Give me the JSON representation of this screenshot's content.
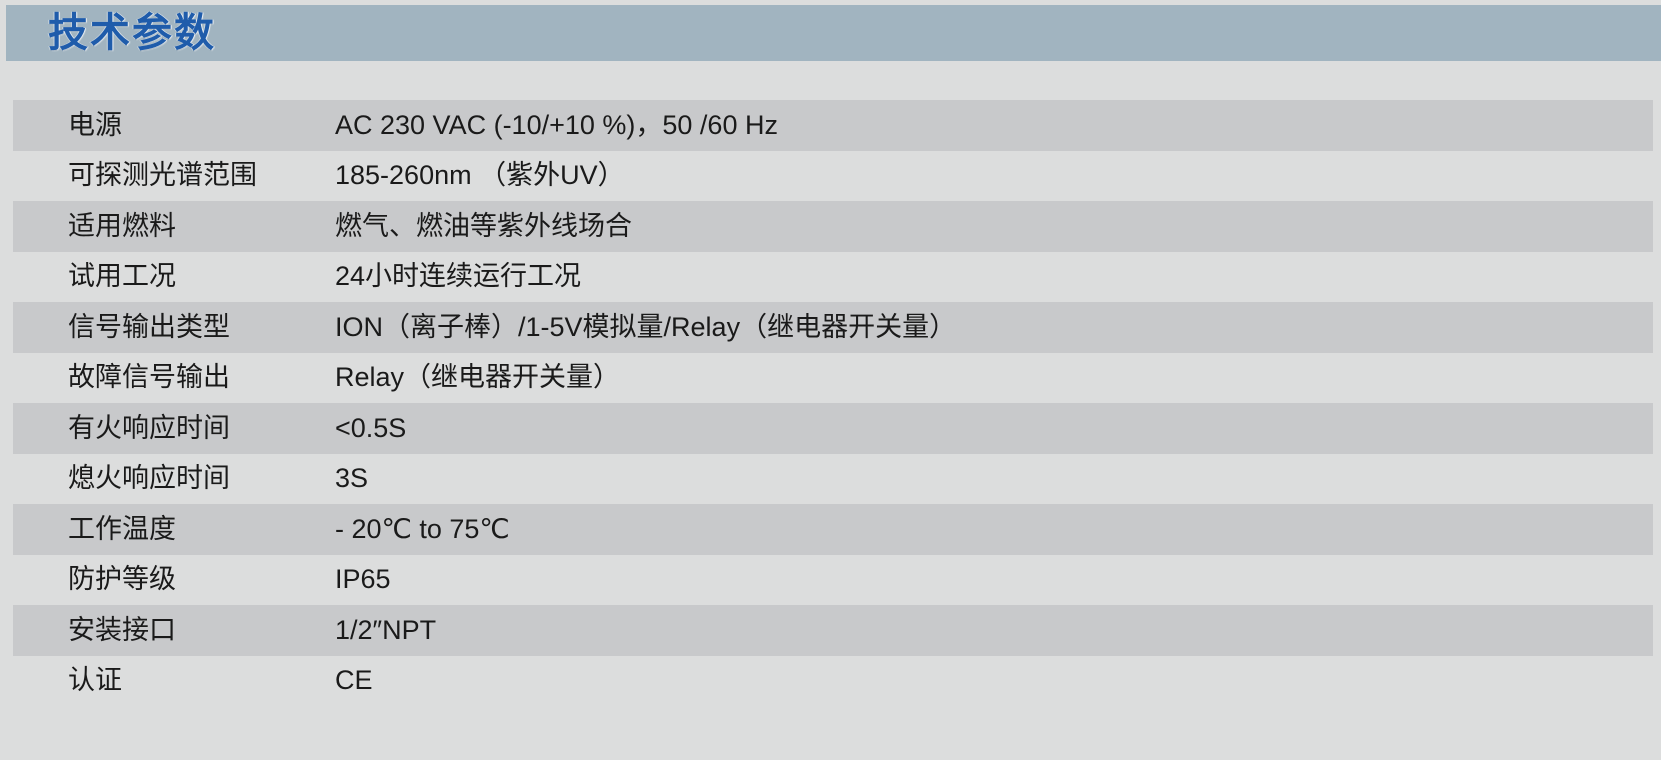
{
  "header": {
    "title": "技术参数",
    "band_color": "#a1b4c0",
    "title_color": "#1f5cab"
  },
  "page": {
    "background_color": "#dcdddd",
    "stripe_color": "#c8c9cb"
  },
  "spec_table": {
    "rows": [
      {
        "label": "电源",
        "value": "AC 230 VAC (-10/+10 %)，50 /60 Hz"
      },
      {
        "label": "可探测光谱范围",
        "value": "185-260nm （紫外UV）"
      },
      {
        "label": "适用燃料",
        "value": "燃气、燃油等紫外线场合"
      },
      {
        "label": "试用工况",
        "value": "24小时连续运行工况"
      },
      {
        "label": "信号输出类型",
        "value": "ION（离子棒）/1-5V模拟量/Relay（继电器开关量）"
      },
      {
        "label": "故障信号输出",
        "value": "Relay（继电器开关量）"
      },
      {
        "label": "有火响应时间",
        "value": "<0.5S"
      },
      {
        "label": "熄火响应时间",
        "value": "3S"
      },
      {
        "label": "工作温度",
        "value": "- 20℃ to 75℃"
      },
      {
        "label": "防护等级",
        "value": "IP65"
      },
      {
        "label": "安装接口",
        "value": "1/2″NPT"
      },
      {
        "label": "认证",
        "value": "CE"
      }
    ]
  }
}
